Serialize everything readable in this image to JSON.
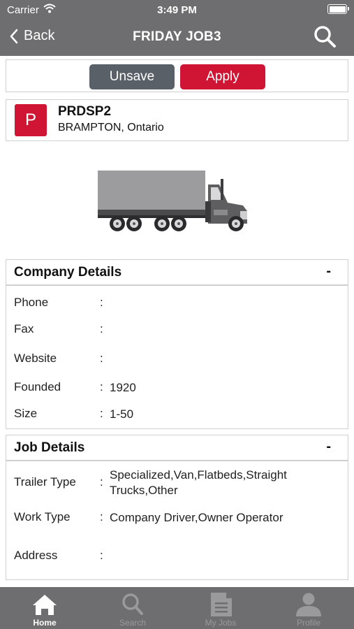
{
  "status_bar": {
    "carrier": "Carrier",
    "time": "3:49 PM"
  },
  "nav": {
    "back_label": "Back",
    "title": "FRIDAY JOB3"
  },
  "actions": {
    "unsave_label": "Unsave",
    "apply_label": "Apply"
  },
  "company": {
    "logo_letter": "P",
    "name": "PRDSP2",
    "location": "BRAMPTON, Ontario"
  },
  "company_details": {
    "header": "Company Details",
    "toggle": "-",
    "rows": [
      {
        "label": "Phone",
        "value": ""
      },
      {
        "label": "Fax",
        "value": ""
      },
      {
        "label": "Website",
        "value": ""
      },
      {
        "label": "Founded",
        "value": "1920"
      },
      {
        "label": "Size",
        "value": "1-50"
      }
    ]
  },
  "job_details": {
    "header": "Job Details",
    "toggle": "-",
    "rows": [
      {
        "label": "Trailer Type",
        "value": "Specialized,Van,Flatbeds,Straight Trucks,Other"
      },
      {
        "label": "Work Type",
        "value": "Company Driver,Owner Operator"
      },
      {
        "label": "Address",
        "value": ""
      }
    ]
  },
  "separator": ":",
  "tabs": [
    {
      "label": "Home",
      "icon": "home-icon",
      "active": true
    },
    {
      "label": "Search",
      "icon": "search-icon",
      "active": false
    },
    {
      "label": "My Jobs",
      "icon": "document-icon",
      "active": false
    },
    {
      "label": "Profile",
      "icon": "person-icon",
      "active": false
    }
  ],
  "colors": {
    "header": "#6e6e70",
    "accent_red": "#d01534",
    "unsave_gray": "#5a6068"
  }
}
